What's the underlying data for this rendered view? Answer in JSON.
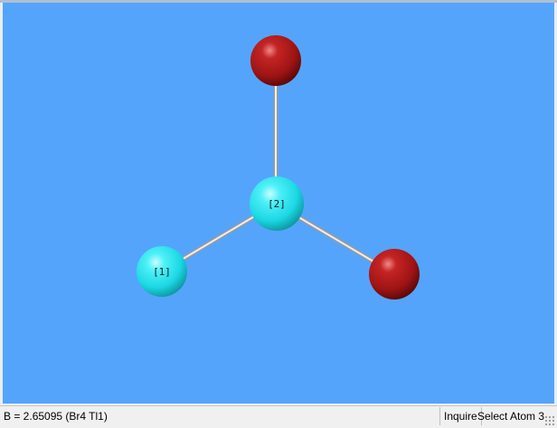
{
  "status_bar": {
    "bond_info": "B = 2.65095 (Br4 Tl1)",
    "mode": "Inquire",
    "hint": "Select Atom 3"
  },
  "molecule": {
    "atoms": [
      {
        "label": "[1]",
        "element": "Tl",
        "color": "#2ce5ee"
      },
      {
        "label": "[2]",
        "element": "Tl",
        "color": "#2ce5ee"
      },
      {
        "label": "",
        "element": "Br",
        "color": "#b01515"
      },
      {
        "label": "",
        "element": "Br",
        "color": "#b01515"
      }
    ]
  },
  "colors": {
    "background": "#55a4fb",
    "bond": "#d8d8d8"
  }
}
